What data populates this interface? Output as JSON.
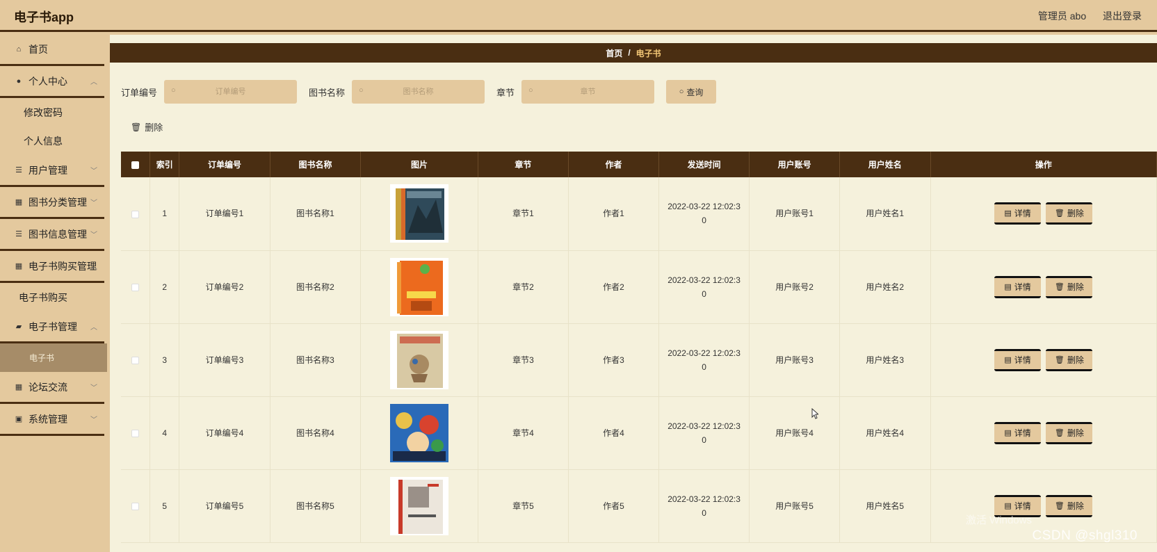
{
  "header": {
    "title": "电子书app",
    "user": "管理员 abo",
    "logout": "退出登录"
  },
  "sidebar": {
    "items": [
      {
        "label": "首页",
        "icon": "home-icon"
      },
      {
        "label": "个人中心",
        "icon": "user-icon"
      },
      {
        "label": "修改密码"
      },
      {
        "label": "个人信息"
      },
      {
        "label": "用户管理",
        "icon": "list-icon"
      },
      {
        "label": "图书分类管理",
        "icon": "grid-icon"
      },
      {
        "label": "图书信息管理",
        "icon": "list-icon"
      },
      {
        "label": "电子书购买管理",
        "icon": "grid-icon"
      },
      {
        "label": "电子书购买"
      },
      {
        "label": "电子书管理",
        "icon": "wallet-icon"
      },
      {
        "label": "电子书"
      },
      {
        "label": "论坛交流",
        "icon": "grid-icon"
      },
      {
        "label": "系统管理",
        "icon": "clipboard-icon"
      }
    ]
  },
  "breadcrumb": {
    "home": "首页",
    "sep": "/",
    "current": "电子书"
  },
  "search": {
    "order_label": "订单编号",
    "order_placeholder": "订单编号",
    "book_label": "图书名称",
    "book_placeholder": "图书名称",
    "chapter_label": "章节",
    "chapter_placeholder": "章节",
    "query_button": "查询"
  },
  "toolbar": {
    "delete_label": "删除"
  },
  "table": {
    "headers": [
      "索引",
      "订单编号",
      "图书名称",
      "图片",
      "章节",
      "作者",
      "发送时间",
      "用户账号",
      "用户姓名",
      "操作"
    ],
    "detail_label": "详情",
    "delete_label": "删除",
    "rows": [
      {
        "index": "1",
        "order": "订单编号1",
        "book": "图书名称1",
        "chapter": "章节1",
        "author": "作者1",
        "time": "2022-03-22 12:02:30",
        "account": "用户账号1",
        "name": "用户姓名1"
      },
      {
        "index": "2",
        "order": "订单编号2",
        "book": "图书名称2",
        "chapter": "章节2",
        "author": "作者2",
        "time": "2022-03-22 12:02:30",
        "account": "用户账号2",
        "name": "用户姓名2"
      },
      {
        "index": "3",
        "order": "订单编号3",
        "book": "图书名称3",
        "chapter": "章节3",
        "author": "作者3",
        "time": "2022-03-22 12:02:30",
        "account": "用户账号3",
        "name": "用户姓名3"
      },
      {
        "index": "4",
        "order": "订单编号4",
        "book": "图书名称4",
        "chapter": "章节4",
        "author": "作者4",
        "time": "2022-03-22 12:02:30",
        "account": "用户账号4",
        "name": "用户姓名4"
      },
      {
        "index": "5",
        "order": "订单编号5",
        "book": "图书名称5",
        "chapter": "章节5",
        "author": "作者5",
        "time": "2022-03-22 12:02:30",
        "account": "用户账号5",
        "name": "用户姓名5"
      }
    ]
  },
  "watermark": "CSDN @shgl310",
  "watermark_cn": "激活 Windows",
  "colors": {
    "accent": "#4a2e12",
    "sidebar_bg": "#e4c99e",
    "content_bg": "#f5f1dc",
    "active_item": "#a68c68",
    "breadcrumb_current": "#f3c776"
  }
}
